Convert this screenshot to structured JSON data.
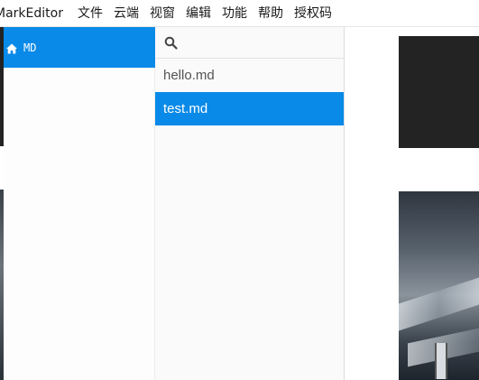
{
  "menubar": {
    "app_name": "MarkEditor",
    "items": [
      {
        "label": "文件"
      },
      {
        "label": "云端"
      },
      {
        "label": "视窗"
      },
      {
        "label": "编辑"
      },
      {
        "label": "功能"
      },
      {
        "label": "帮助"
      },
      {
        "label": "授权码"
      }
    ]
  },
  "sidebar": {
    "folder": {
      "icon": "home-icon",
      "label": "MD"
    }
  },
  "filelist": {
    "search": {
      "icon": "search-icon",
      "value": "",
      "placeholder": ""
    },
    "files": [
      {
        "name": "hello.md",
        "selected": false
      },
      {
        "name": "test.md",
        "selected": true
      }
    ]
  },
  "colors": {
    "accent": "#0a8ae8",
    "menu_text": "#1a1a1a",
    "file_text": "#555555",
    "desktop_dark": "#232323"
  }
}
